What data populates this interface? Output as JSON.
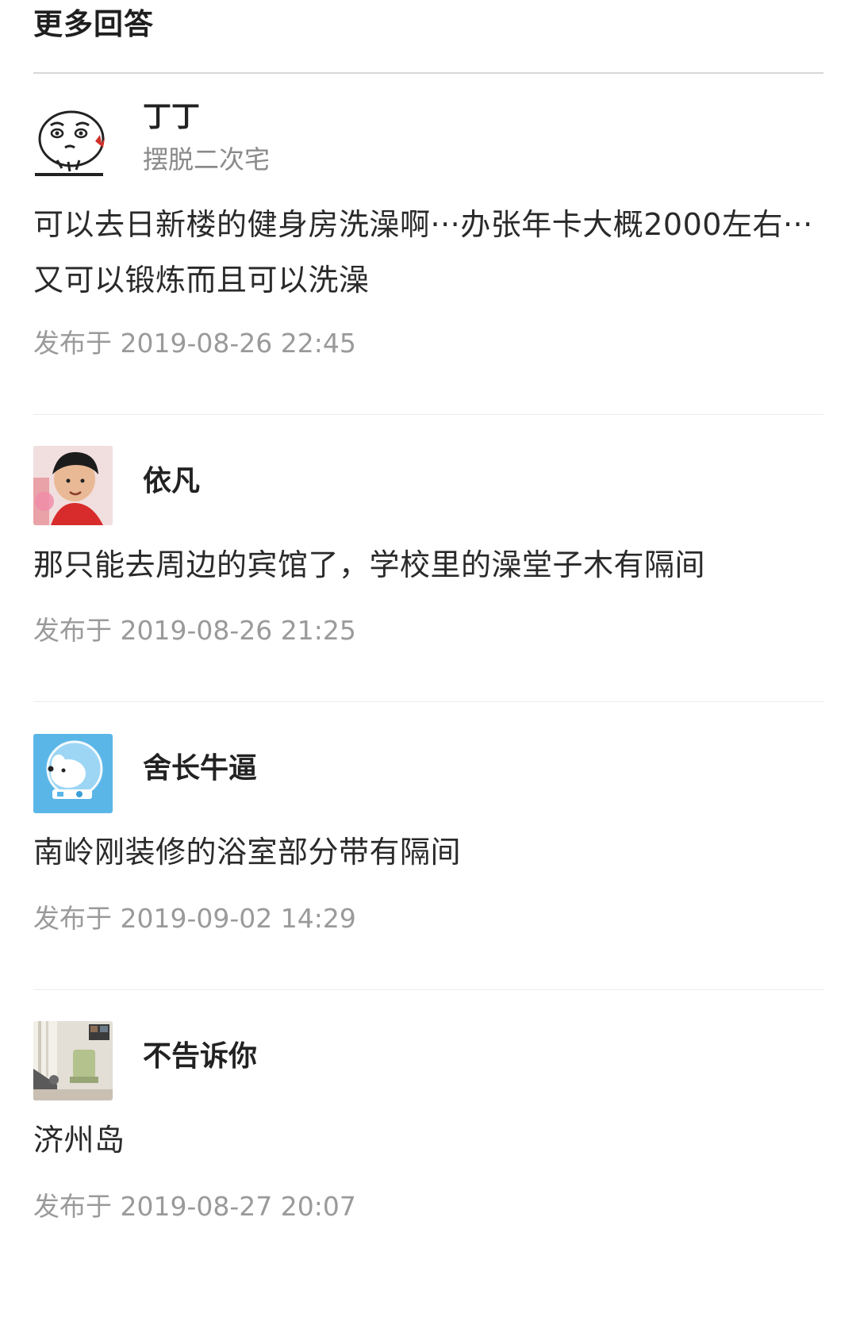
{
  "section": {
    "title": "更多回答"
  },
  "answers": [
    {
      "user_name": "丁丁",
      "user_sub": "摆脱二次宅",
      "avatar_icon": "cartoon-face-avatar",
      "content": "可以去日新楼的健身房洗澡啊···办张年卡大概2000左右···又可以锻炼而且可以洗澡",
      "published": "发布于 2019-08-26 22:45"
    },
    {
      "user_name": "依凡",
      "avatar_icon": "photo-avatar-person",
      "content": "那只能去周边的宾馆了，学校里的澡堂子木有隔间",
      "published": "发布于 2019-08-26 21:25"
    },
    {
      "user_name": "舍长牛逼",
      "avatar_icon": "astronaut-dog-avatar",
      "content": "南岭刚装修的浴室部分带有隔间",
      "published": "发布于 2019-09-02 14:29"
    },
    {
      "user_name": "不告诉你",
      "avatar_icon": "room-photo-avatar",
      "content": "济州岛",
      "published": "发布于 2019-08-27 20:07"
    }
  ],
  "colors": {
    "title": "#1f1f1f",
    "name": "#222222",
    "sub": "#8a8a8a",
    "time": "#9a9a9a",
    "divider": "#ececec"
  }
}
